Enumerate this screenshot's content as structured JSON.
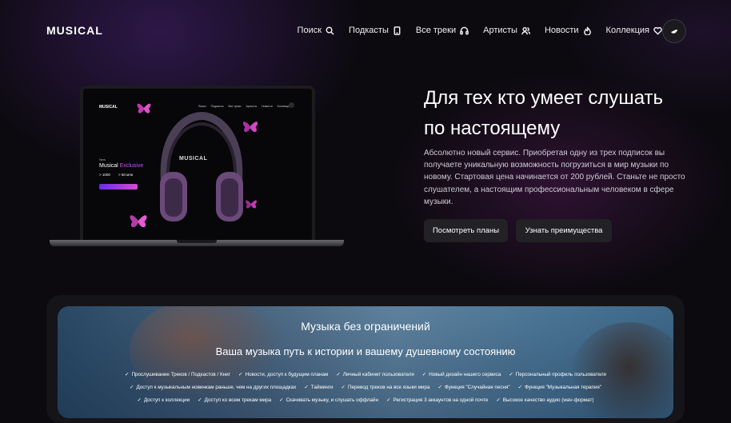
{
  "header": {
    "logo": "MUSICAL",
    "nav": [
      {
        "label": "Поиск",
        "icon": "search-icon"
      },
      {
        "label": "Подкасты",
        "icon": "tablet-icon"
      },
      {
        "label": "Все треки",
        "icon": "headphones-icon"
      },
      {
        "label": "Артисты",
        "icon": "users-icon"
      },
      {
        "label": "Новости",
        "icon": "flame-icon"
      },
      {
        "label": "Коллекция",
        "icon": "heart-icon"
      }
    ],
    "avatar_icon": "leaf-icon"
  },
  "laptop": {
    "logo": "MUSICAL",
    "nav": [
      "Поиск",
      "Подкасты",
      "Все треки",
      "Артисты",
      "Новости",
      "Коллекция"
    ],
    "new_label": "New",
    "title_main": "Musical ",
    "title_accent": "Exclusive",
    "stat1": "> 1000",
    "stat2": "> 50 млн",
    "brand": "MUSICAL",
    "accent_color": "#c25be6"
  },
  "hero": {
    "title": "Для тех кто умеет слушать по настоящему",
    "description": "Абсолютно новый сервис. Приобретая одну из трех подписок вы получаете уникальную возможность погрузиться в мир музыки по новому. Стартовая цена начинается от 200 рублей. Станьте не просто слушателем, а настоящим профессиональным человеком в сфере музыки.",
    "btn_plans": "Посмотреть планы",
    "btn_benefits": "Узнать преимущества"
  },
  "banner": {
    "title": "Музыка без ограничений",
    "subtitle": "Ваша музыка путь к истории и вашему душевному состоянию",
    "features": [
      [
        "Прослушивание Треков / Подкастов / Книг",
        "Новости, доступ к будущим планам",
        "Личный кабинет пользователя",
        "Новый дизайн нашего сервиса",
        "Персональный профиль пользователя"
      ],
      [
        "Доступ к музыкальным новинкам раньше, чем на других площадках",
        "Тайминги",
        "Перевод треков на все языки мира",
        "Функция \"Случайная песня\"",
        "Функция \"Музыкальная терапия\""
      ],
      [
        "Доступ к коллекции",
        "Доступ ко всем трекам мира",
        "Скачивать музыку, и слушать оффлайн",
        "Регистрация 3 аккаунтов на одной почте",
        "Высокое качество аудио (wav-формат)"
      ]
    ]
  }
}
